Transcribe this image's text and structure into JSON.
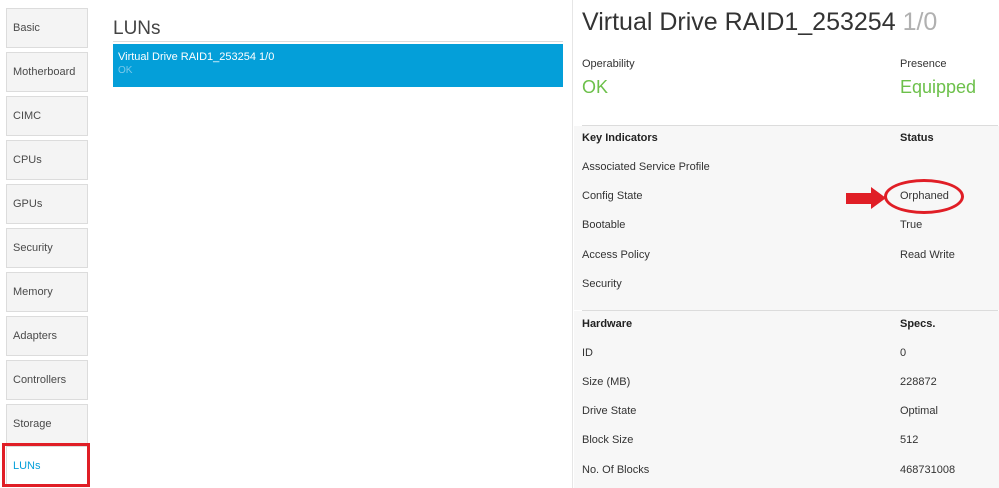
{
  "sidebar": {
    "items": [
      {
        "label": "Basic"
      },
      {
        "label": "Motherboard"
      },
      {
        "label": "CIMC"
      },
      {
        "label": "CPUs"
      },
      {
        "label": "GPUs"
      },
      {
        "label": "Security"
      },
      {
        "label": "Memory"
      },
      {
        "label": "Adapters"
      },
      {
        "label": "Controllers"
      },
      {
        "label": "Storage"
      },
      {
        "label": "LUNs"
      }
    ],
    "active": "LUNs"
  },
  "luns": {
    "title": "LUNs",
    "items": [
      {
        "name": "Virtual Drive RAID1_253254 1/0",
        "status": "OK"
      }
    ]
  },
  "detail": {
    "title": "Virtual Drive RAID1_253254",
    "title_suffix": "1/0",
    "operability_label": "Operability",
    "operability_value": "OK",
    "presence_label": "Presence",
    "presence_value": "Equipped",
    "key_indicators": {
      "header": "Key Indicators",
      "status_header": "Status",
      "rows": [
        {
          "label": "Associated Service Profile",
          "value": ""
        },
        {
          "label": "Config State",
          "value": "Orphaned"
        },
        {
          "label": "Bootable",
          "value": "True"
        },
        {
          "label": "Access Policy",
          "value": "Read Write"
        },
        {
          "label": "Security",
          "value": ""
        }
      ]
    },
    "hardware": {
      "header": "Hardware",
      "specs_header": "Specs.",
      "rows": [
        {
          "label": "ID",
          "value": "0"
        },
        {
          "label": "Size (MB)",
          "value": "228872"
        },
        {
          "label": "Drive State",
          "value": "Optimal"
        },
        {
          "label": "Block Size",
          "value": "512"
        },
        {
          "label": "No. Of Blocks",
          "value": "468731008"
        }
      ]
    }
  },
  "colors": {
    "accent": "#049fd9",
    "ok": "#6cc04a",
    "annotation": "#e01e26"
  }
}
